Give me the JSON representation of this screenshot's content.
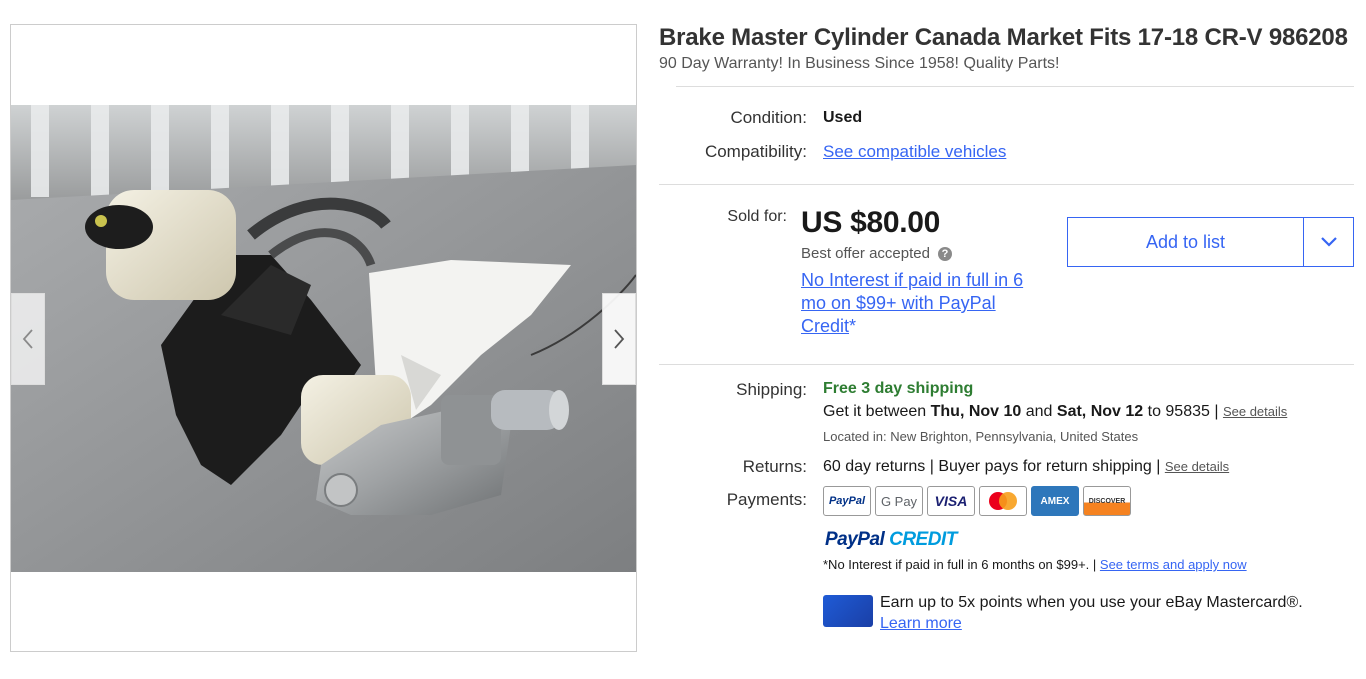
{
  "gallery": {
    "prev_arrow": "‹",
    "next_arrow": "›"
  },
  "listing": {
    "title": "Brake Master Cylinder Canada Market Fits 17-18 CR-V 986208",
    "subtitle": "90 Day Warranty! In Business Since 1958! Quality Parts!"
  },
  "condition": {
    "label": "Condition:",
    "value": "Used"
  },
  "compatibility": {
    "label": "Compatibility:",
    "link": "See compatible vehicles"
  },
  "price": {
    "label": "Sold for:",
    "amount": "US $80.00",
    "offer_status": "Best offer accepted",
    "help_icon": "?",
    "paypal_link": "No Interest if paid in full in 6 mo on $99+ with PayPal Credit",
    "paypal_suffix": "*"
  },
  "actions": {
    "add_to_list": "Add to list"
  },
  "shipping": {
    "label": "Shipping:",
    "headline": "Free 3 day shipping",
    "delivery_prefix": "Get it between ",
    "date_start": "Thu, Nov 10",
    "delivery_and": " and ",
    "date_end": "Sat, Nov 12",
    "delivery_to": " to 95835 | ",
    "details_link": "See details",
    "location": "Located in: New Brighton, Pennsylvania, United States"
  },
  "returns": {
    "label": "Returns:",
    "value": "60 day returns | Buyer pays for return shipping | ",
    "details_link": "See details"
  },
  "payments": {
    "label": "Payments:",
    "methods": [
      "PayPal",
      "G Pay",
      "VISA",
      "Mastercard",
      "AMEX",
      "DISCOVER"
    ],
    "credit_logo_1": "PayPal",
    "credit_logo_2": "CREDIT",
    "credit_note": "*No Interest if paid in full in 6 months on $99+. | ",
    "credit_link": "See terms and apply now",
    "mastercard_promo": "Earn up to 5x points when you use your eBay Mastercard®.",
    "learn_more": "Learn more"
  },
  "colors": {
    "link": "#3665f3",
    "shipping_green": "#2e7d32",
    "paypal_dark": "#003087",
    "paypal_light": "#009cde"
  }
}
